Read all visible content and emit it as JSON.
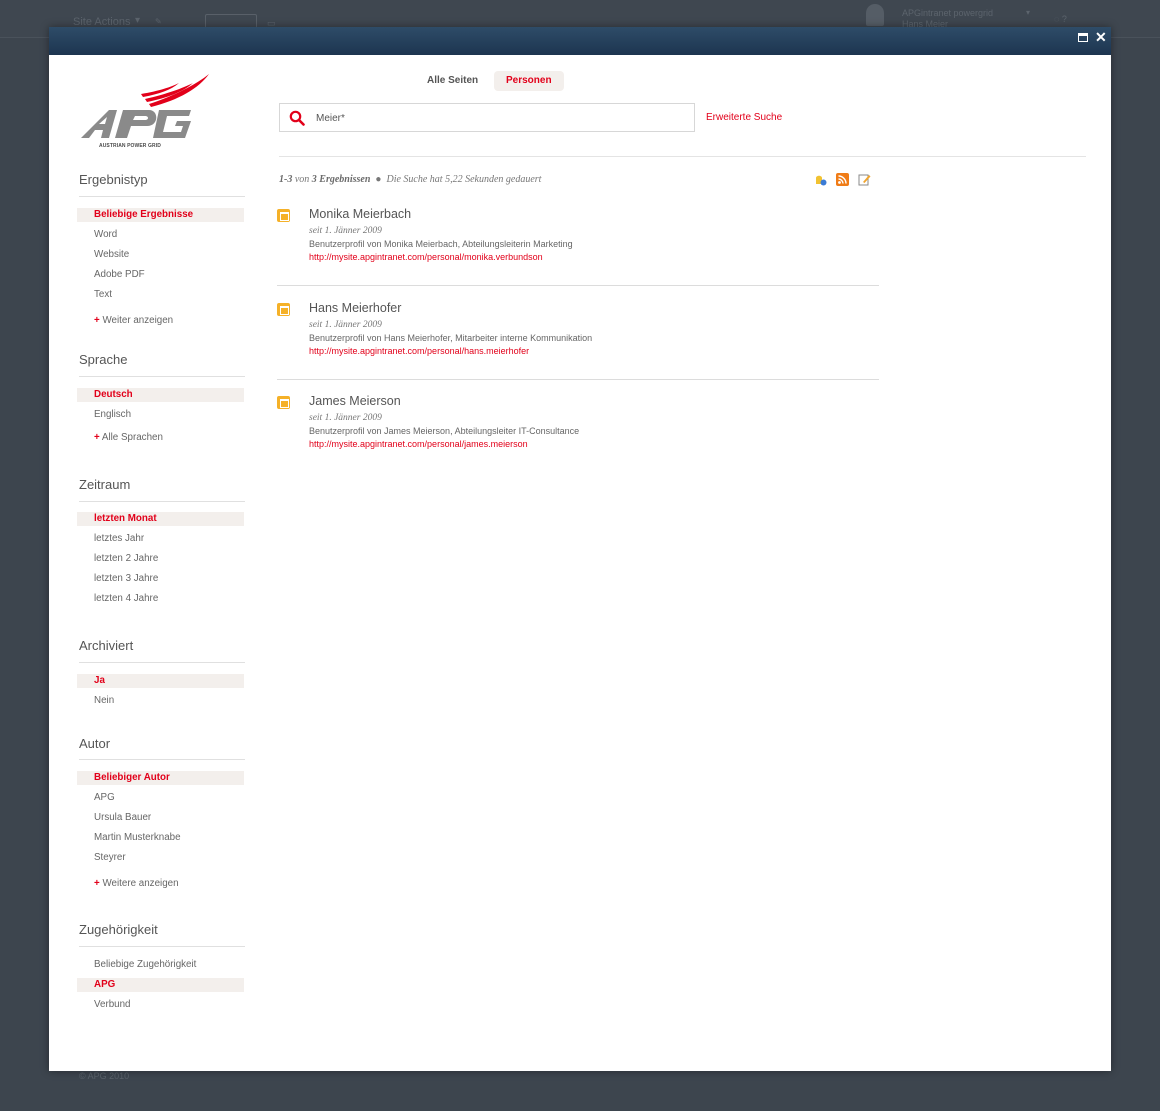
{
  "bg": {
    "site_actions": "Site Actions",
    "user_line1": "APGintranet powergrid",
    "user_line2": "Hans Meier",
    "footer": "© APG 2010"
  },
  "tabs": [
    {
      "label": "Alle Seiten",
      "active": false
    },
    {
      "label": "Personen",
      "active": true
    }
  ],
  "search": {
    "query": "Meier*",
    "advanced_label": "Erweiterte Suche"
  },
  "summary": {
    "range": "1-3",
    "of": "von",
    "count": "3 Ergebnissen",
    "duration": "Die Suche hat 5,22 Sekunden gedauert"
  },
  "results": [
    {
      "name": "Monika Meierbach",
      "since": "seit 1. Jänner 2009",
      "description": "Benutzerprofil von Monika Meierbach, Abteilungsleiterin Marketing",
      "url": "http://mysite.apgintranet.com/personal/monika.verbundson"
    },
    {
      "name": "Hans Meierhofer",
      "since": "seit 1. Jänner 2009",
      "description": "Benutzerprofil von Hans Meierhofer, Mitarbeiter interne Kommunikation",
      "url": "http://mysite.apgintranet.com/personal/hans.meierhofer"
    },
    {
      "name": "James Meierson",
      "since": "seit 1. Jänner 2009",
      "description": "Benutzerprofil von James Meierson, Abteilungsleiter IT-Consultance",
      "url": "http://mysite.apgintranet.com/personal/james.meierson"
    }
  ],
  "logo_text": "AUSTRIAN POWER GRID",
  "filters": {
    "ergebnistyp": {
      "heading": "Ergebnistyp",
      "items": [
        "Beliebige Ergebnisse",
        "Word",
        "Website",
        "Adobe PDF",
        "Text"
      ],
      "more": "Weiter anzeigen"
    },
    "sprache": {
      "heading": "Sprache",
      "items": [
        "Deutsch",
        "Englisch"
      ],
      "more": "Alle Sprachen"
    },
    "zeitraum": {
      "heading": "Zeitraum",
      "items": [
        "letzten Monat",
        "letztes Jahr",
        "letzten 2 Jahre",
        "letzten 3 Jahre",
        "letzten 4 Jahre"
      ]
    },
    "archiviert": {
      "heading": "Archiviert",
      "items": [
        "Ja",
        "Nein"
      ]
    },
    "autor": {
      "heading": "Autor",
      "items": [
        "Beliebiger Autor",
        "APG",
        "Ursula Bauer",
        "Martin Musterknabe",
        "Steyrer"
      ],
      "more": "Weitere anzeigen"
    },
    "zugehoerigkeit": {
      "heading": "Zugehörigkeit",
      "items": [
        "Beliebige Zugehörigkeit",
        "APG",
        "Verbund"
      ]
    }
  },
  "colors": {
    "accent": "#e2001a",
    "active_bg": "#f3efec",
    "title_bar": "#1d3550",
    "backdrop": "#3d454e"
  }
}
